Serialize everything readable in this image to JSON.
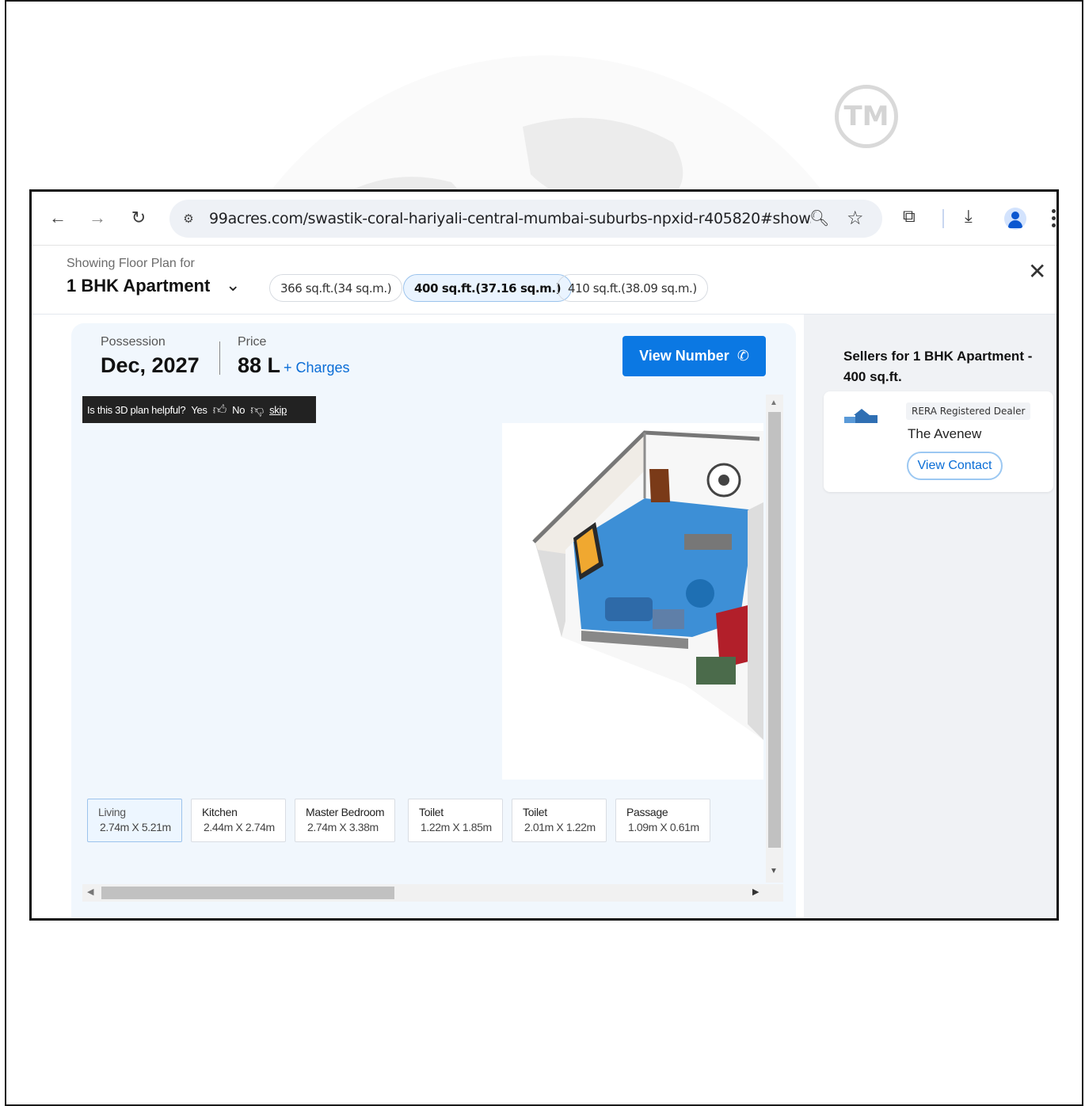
{
  "browser": {
    "url": "99acres.com/swastik-coral-hariyali-central-mumbai-suburbs-npxid-r405820#show...",
    "icons": [
      "back-arrow-icon",
      "forward-arrow-icon",
      "reload-icon",
      "site-settings-icon",
      "zoom-icon",
      "bookmark-star-icon",
      "extensions-icon",
      "download-icon",
      "profile-icon",
      "menu-kebab-icon"
    ]
  },
  "watermark": {
    "tm": "TM"
  },
  "floor_plan": {
    "showing_label": "Showing Floor Plan for",
    "type_label": "1 BHK Apartment",
    "sizes": [
      {
        "label": "366 sq.ft.(34 sq.m.)",
        "active": false
      },
      {
        "label": "400 sq.ft.(37.16 sq.m.)",
        "active": true
      },
      {
        "label": "410 sq.ft.(38.09 sq.m.)",
        "active": false
      }
    ],
    "possession_label": "Possession",
    "possession_value": "Dec, 2027",
    "price_label": "Price",
    "price_value": "88 L",
    "charges_link": "+ Charges",
    "view_number_label": "View Number",
    "feedback": {
      "question": "Is this 3D plan helpful?",
      "yes": "Yes",
      "no": "No",
      "skip": "skip"
    },
    "rooms": [
      {
        "name": "Living",
        "size": "2.74m X 5.21m",
        "active": true
      },
      {
        "name": "Kitchen",
        "size": "2.44m X 2.74m",
        "active": false
      },
      {
        "name": "Master Bedroom",
        "size": "2.74m X 3.38m",
        "active": false
      },
      {
        "name": "Toilet",
        "size": "1.22m X 1.85m",
        "active": false
      },
      {
        "name": "Toilet",
        "size": "2.01m X 1.22m",
        "active": false
      },
      {
        "name": "Passage",
        "size": "1.09m X 0.61m",
        "active": false
      }
    ]
  },
  "sellers": {
    "title": "Sellers for 1 BHK Apartment - 400 sq.ft.",
    "seller": {
      "badge": "RERA Registered Dealer",
      "name": "The Avenew",
      "contact_label": "View Contact"
    }
  },
  "colors": {
    "accent": "#0b78e3",
    "link": "#0a6dd6",
    "panel_bg": "#f1f7fd",
    "sidebar_bg": "#f0f2f5",
    "living_highlight": "#3d8fd6"
  }
}
